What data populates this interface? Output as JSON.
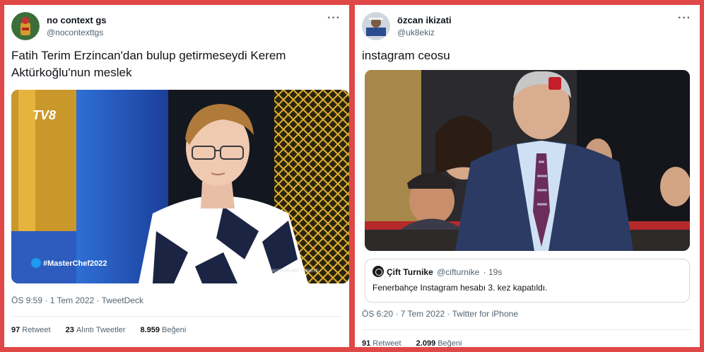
{
  "left_tweet": {
    "display_name": "no context gs",
    "handle": "@nocontexttgs",
    "more_icon": "more-dots-icon",
    "text": "Fatih Terim Erzincan'dan bulup getirmeseydi Kerem Aktürkoğlu'nun meslek",
    "media": {
      "channel_logo": "TV8",
      "hashtag": "#MasterChef2022",
      "watermark": "MASTERCHEF TÜRKİYE"
    },
    "meta": "ÖS 9:59 · 1 Tem 2022 · TweetDeck",
    "stats": [
      {
        "value": "97",
        "label": "Retweet"
      },
      {
        "value": "23",
        "label": "Alıntı Tweetler"
      },
      {
        "value": "8.959",
        "label": "Beğeni"
      }
    ]
  },
  "right_tweet": {
    "display_name": "özcan ikizati",
    "handle": "@uk8ekiz",
    "more_icon": "more-dots-icon",
    "text": "instagram ceosu",
    "quote": {
      "name": "Çift Turnike",
      "handle": "@cifturnike",
      "age": "· 19s",
      "text": "Fenerbahçe Instagram hesabı 3. kez kapatıldı."
    },
    "meta": "ÖS 6:20 · 7 Tem 2022 · Twitter for iPhone",
    "stats": [
      {
        "value": "91",
        "label": "Retweet"
      },
      {
        "value": "2.099",
        "label": "Beğeni"
      }
    ]
  },
  "colors": {
    "frame": "#e04848",
    "card": "#ffffff",
    "secondary_text": "#536471",
    "primary_text": "#0f1419"
  }
}
